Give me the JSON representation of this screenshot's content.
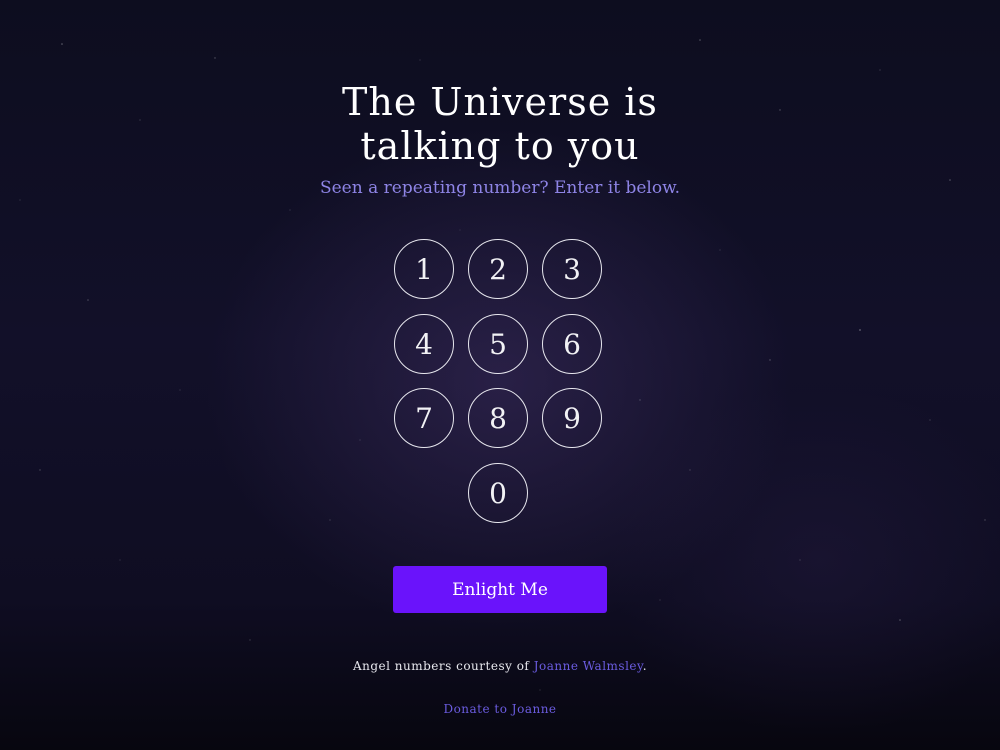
{
  "header": {
    "title_line1": "The Universe is",
    "title_line2": "talking to you",
    "subtitle": "Seen a repeating number? Enter it below."
  },
  "keypad": {
    "keys": [
      "1",
      "2",
      "3",
      "4",
      "5",
      "6",
      "7",
      "8",
      "9",
      "0"
    ]
  },
  "submit_label": "Enlight Me",
  "footer": {
    "credit_prefix": "Angel numbers courtesy of",
    "credit_link": "Joanne Walmsley",
    "credit_suffix": ".",
    "donate_label": "Donate to Joanne"
  },
  "colors": {
    "background": "#121029",
    "accent_button": "#6a13fb",
    "subtitle_text": "#8e84e6",
    "link_text": "#6b5ce0",
    "key_border": "#e7e7ee"
  }
}
